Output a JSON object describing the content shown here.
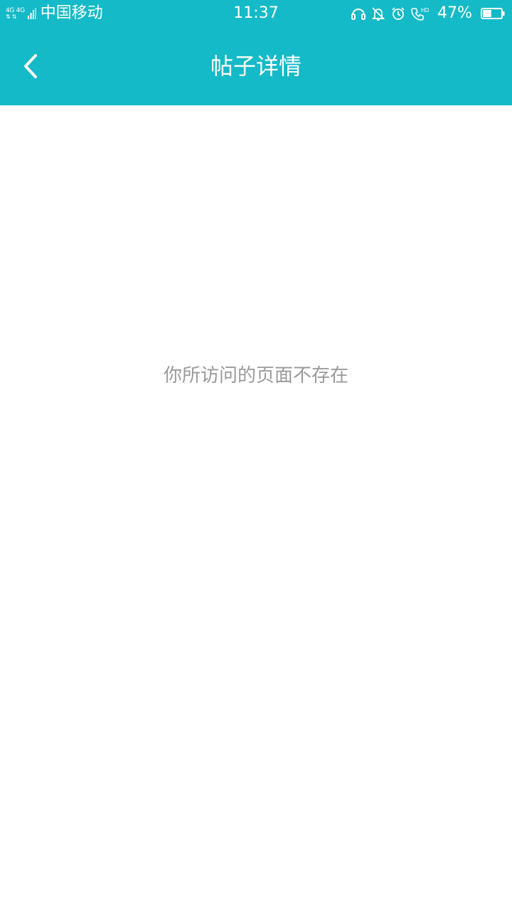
{
  "status_bar": {
    "network_label": "4G 4G",
    "carrier": "中国移动",
    "time": "11:37",
    "battery_percent": "47%",
    "battery_level": 0.47,
    "icons": [
      "headset-icon",
      "mute-bell-icon",
      "alarm-icon",
      "hd-call-icon",
      "battery-icon"
    ]
  },
  "header": {
    "title": "帖子详情",
    "back_icon": "chevron-left-icon"
  },
  "content": {
    "empty_message": "你所访问的页面不存在"
  },
  "colors": {
    "accent": "#14bac8",
    "background": "#ffffff",
    "message_text": "#9a9a9a"
  }
}
